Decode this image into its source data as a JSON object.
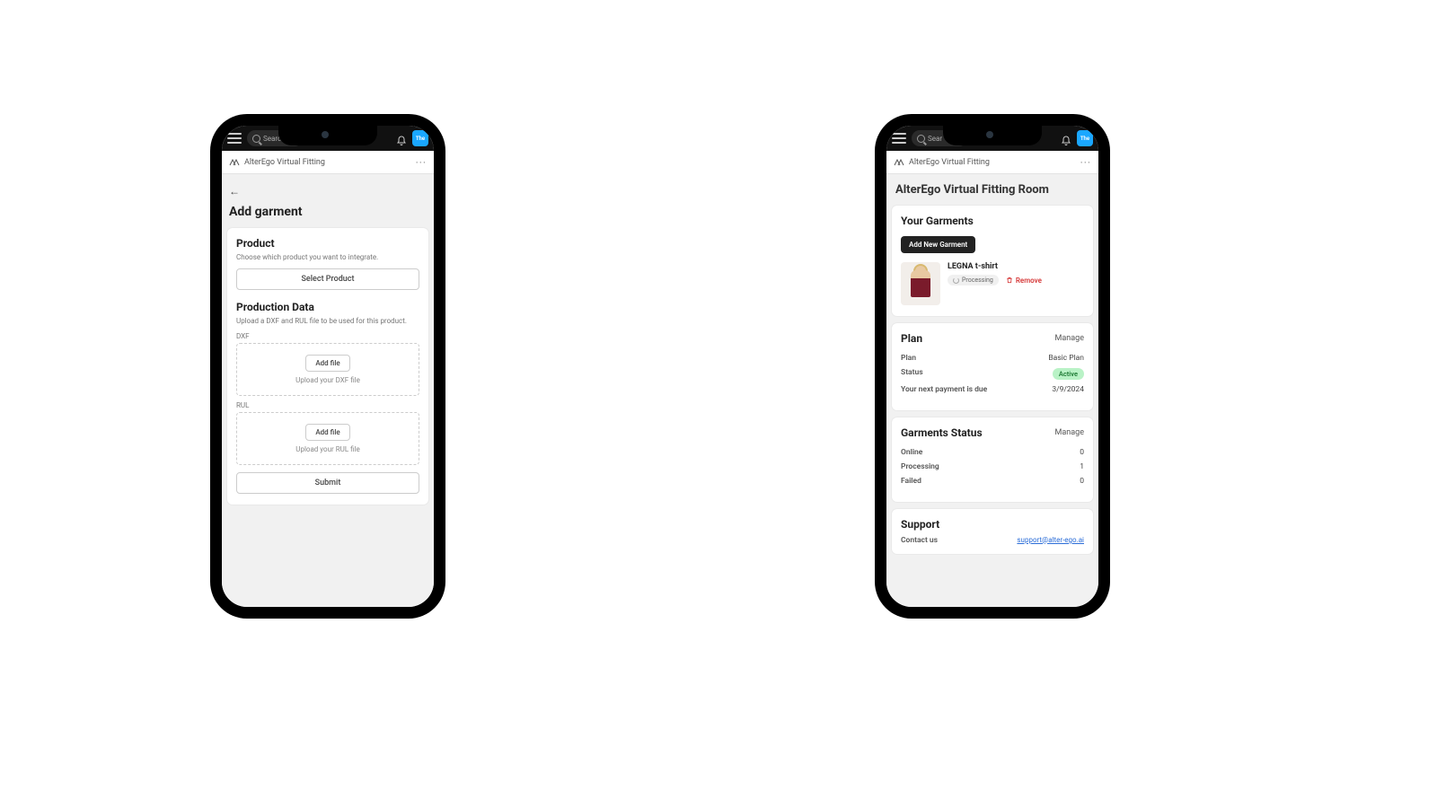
{
  "common": {
    "search_placeholder_left": "Searc",
    "search_placeholder_right": "Sear",
    "app_name": "AlterEgo Virtual Fitting",
    "avatar_label": "The"
  },
  "left": {
    "page_title": "Add garment",
    "product_section": {
      "title": "Product",
      "desc": "Choose which product you want to integrate.",
      "select_button": "Select Product"
    },
    "production_section": {
      "title": "Production Data",
      "desc": "Upload a DXF and RUL file to be used for this product.",
      "dxf": {
        "label": "DXF",
        "add_file": "Add file",
        "hint": "Upload your DXF file"
      },
      "rul": {
        "label": "RUL",
        "add_file": "Add file",
        "hint": "Upload your RUL file"
      }
    },
    "submit_label": "Submit"
  },
  "right": {
    "page_title": "AlterEgo Virtual Fitting Room",
    "garments_section": {
      "title": "Your Garments",
      "add_new": "Add New Garment",
      "items": [
        {
          "name": "LEGNA t-shirt",
          "status": "Processing",
          "remove": "Remove"
        }
      ]
    },
    "plan_section": {
      "title": "Plan",
      "manage": "Manage",
      "rows": {
        "plan_k": "Plan",
        "plan_v": "Basic Plan",
        "status_k": "Status",
        "status_v": "Active",
        "due_k": "Your next payment is due",
        "due_v": "3/9/2024"
      }
    },
    "status_section": {
      "title": "Garments Status",
      "manage": "Manage",
      "rows": {
        "online_k": "Online",
        "online_v": "0",
        "processing_k": "Processing",
        "processing_v": "1",
        "failed_k": "Failed",
        "failed_v": "0"
      }
    },
    "support_section": {
      "title": "Support",
      "contact_k": "Contact us",
      "contact_v": "support@alter-ego.ai"
    }
  }
}
